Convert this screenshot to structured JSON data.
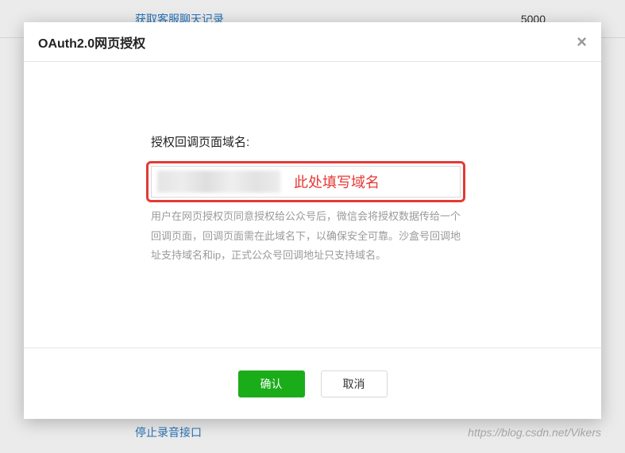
{
  "bg": {
    "top_link": "获取客服聊天记录",
    "top_num": "5000",
    "bottom_link": "停止录音接口",
    "watermark": "https://blog.csdn.net/Vikers"
  },
  "modal": {
    "title": "OAuth2.0网页授权",
    "close_glyph": "×",
    "field_label": "授权回调页面域名:",
    "input_value": "",
    "annotation": "此处填写域名",
    "help": "用户在网页授权页同意授权给公众号后，微信会将授权数据传给一个回调页面，回调页面需在此域名下，以确保安全可靠。沙盒号回调地址支持域名和ip，正式公众号回调地址只支持域名。",
    "confirm_label": "确认",
    "cancel_label": "取消"
  }
}
